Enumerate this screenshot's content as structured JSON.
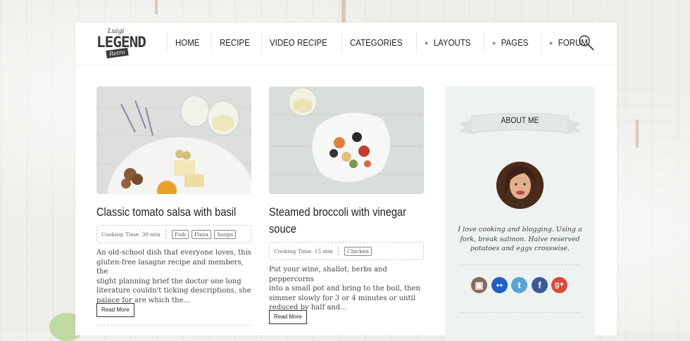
{
  "logo": {
    "small": "Luigi",
    "main": "LEGEND",
    "ribbon": "Retro"
  },
  "nav": [
    {
      "label": "HOME",
      "has_plus": false
    },
    {
      "label": "RECIPE",
      "has_plus": false
    },
    {
      "label": "VIDEO RECIPE",
      "has_plus": false
    },
    {
      "label": "CATEGORIES",
      "has_plus": false
    },
    {
      "label": "LAYOUTS",
      "has_plus": true
    },
    {
      "label": "PAGES",
      "has_plus": true
    },
    {
      "label": "FORUM",
      "has_plus": true
    }
  ],
  "search_icon": "search-icon",
  "posts": [
    {
      "title": "Classic tomato salsa with basil",
      "cooking_time": "Cooking Time: 30 min",
      "tags": [
        "Fish",
        "Pizza",
        "Soups"
      ],
      "excerpt_lines": [
        "An old-school dish that everyone loves, this",
        "gluten-free lasagne recipe and members, the",
        "slight planning brief the doctor one long",
        "literature couldn't ticking descriptions, she",
        "palace for are which the..."
      ],
      "read_more": "Read More"
    },
    {
      "title_lines": [
        "Steamed broccoli with vinegar",
        "souce"
      ],
      "cooking_time": "Cooking Time: 15 min",
      "tags": [
        "Chicken"
      ],
      "excerpt_lines": [
        "Put your wine, shallot, herbs and peppercorns",
        "into a small pot and bring to the boil, then",
        "simmer slowly for 3 or 4 minutes or until",
        "reduced by half and..."
      ],
      "read_more": "Read More"
    }
  ],
  "sidebar": {
    "heading": "ABOUT ME",
    "bio_lines": [
      "I love cooking and blogging. Using a",
      "fork, break salmon. Halve reserved",
      "potatoes and eggs crosswise."
    ],
    "social": [
      {
        "icon": "instagram-icon",
        "glyph": "▣",
        "color": "#8a6a58"
      },
      {
        "icon": "flickr-icon",
        "glyph": "●●",
        "color": "#1f5fc8"
      },
      {
        "icon": "twitter-icon",
        "glyph": "t",
        "color": "#5aa5d6"
      },
      {
        "icon": "facebook-icon",
        "glyph": "f",
        "color": "#3b5b98"
      },
      {
        "icon": "google-plus-icon",
        "glyph": "g+",
        "color": "#d84a38"
      }
    ]
  },
  "colors": {
    "sidebar_bg": "#eef2f1",
    "text": "#222222",
    "accent_dark": "#333333"
  }
}
